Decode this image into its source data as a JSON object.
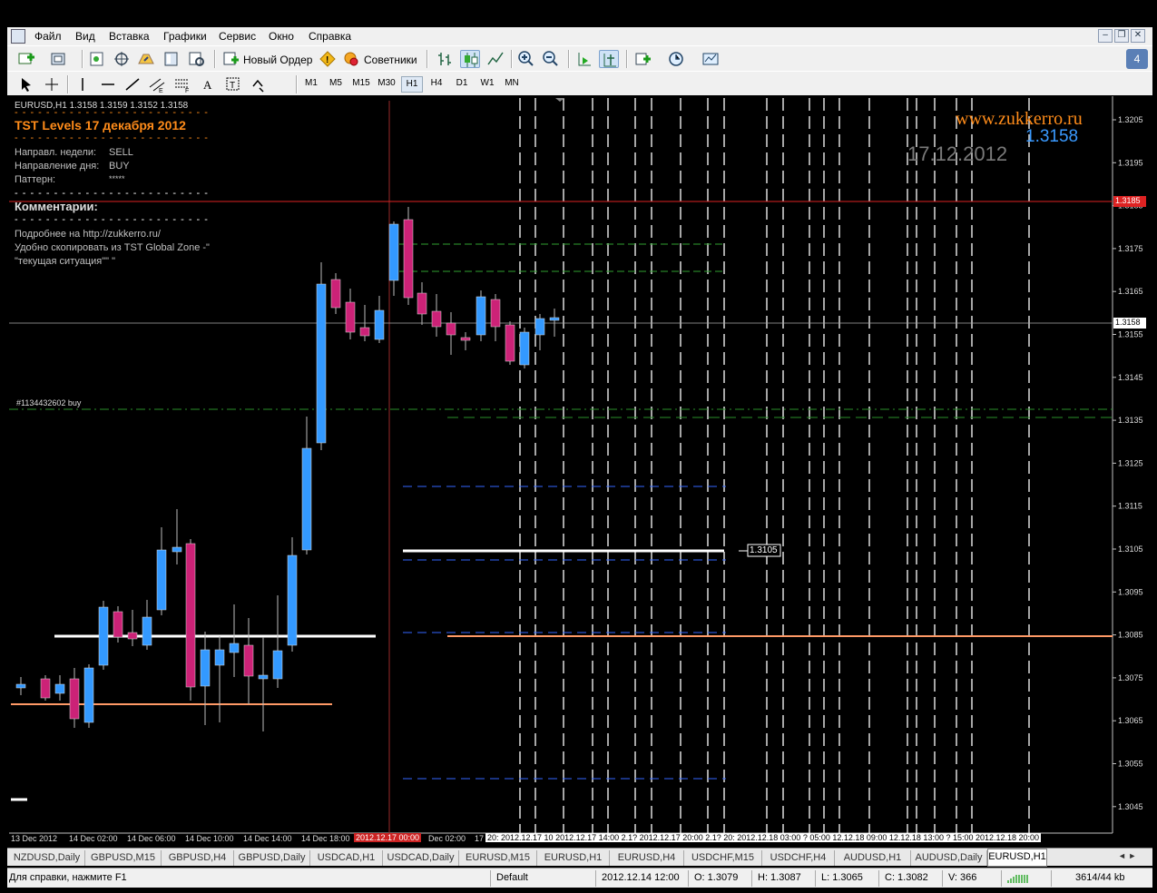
{
  "menu": [
    "Файл",
    "Вид",
    "Вставка",
    "Графики",
    "Сервис",
    "Окно",
    "Справка"
  ],
  "toolbar": {
    "new_order": "Новый Ордер",
    "advisors": "Советники",
    "timeframes": [
      "M1",
      "M5",
      "M15",
      "M30",
      "H1",
      "H4",
      "D1",
      "W1",
      "MN"
    ],
    "active_timeframe": "H1",
    "badge_count": "4"
  },
  "chart": {
    "symbol_header": "EURUSD,H1  1.3158 1.3159 1.3152 1.3158",
    "panel": {
      "title": "TST Levels   17 декабря 2012",
      "dashes": "- - - - - - - - - - - - - - - - - - - - - - - - -",
      "rows": [
        {
          "label": "Направл. недели:",
          "value": "SELL"
        },
        {
          "label": "Направление дня:",
          "value": "BUY"
        },
        {
          "label": "Паттерн:",
          "value": "*****"
        }
      ],
      "comments_title": "Комментарии:",
      "comment_line1": "Подробнее на  http://zukkerro.ru/",
      "comment_line2": "Удобно скопировать из TST Global Zone -\"",
      "comment_line3": "\"текущая ситуация\"\" \""
    },
    "watermark_url": "www.zukkerro.ru",
    "watermark_price": "1.3158",
    "watermark_date": "17.12.2012",
    "order_label": "#1134432602 buy",
    "level_label": "1.3105",
    "price_axis": [
      "1.3205",
      "1.3195",
      "1.3185",
      "1.3175",
      "1.3165",
      "1.3155",
      "1.3145",
      "1.3135",
      "1.3125",
      "1.3115",
      "1.3105",
      "1.3095",
      "1.3085",
      "1.3075",
      "1.3065",
      "1.3055",
      "1.3045"
    ],
    "price_red_marker": "1.3185",
    "price_current_marker": "1.3158",
    "time_axis": [
      "13 Dec 2012",
      "14 Dec 02:00",
      "14 Dec 06:00",
      "14 Dec 10:00",
      "14 Dec 14:00",
      "14 Dec 18:00",
      "2012.12.17 00:00",
      "Dec 02:00",
      "17"
    ],
    "time_axis_future": "20: 2012.12.17 10  2012.12.17 14:00  2.1? 2012.12.17 20:00  2.1? 20: 2012.12.18 03:00  ? 05:00 12.12.18 09:00 12.12.18 13:00 ? 15:00  2012.12.18 20:00",
    "colors": {
      "bull": "#3399ff",
      "bear": "#cc2277",
      "red_line": "#ff2222",
      "orange_line": "#ff9966",
      "green_dash": "#33cc33",
      "blue_dash": "#3366ff"
    }
  },
  "tabs": [
    "NZDUSD,Daily",
    "GBPUSD,M15",
    "GBPUSD,H4",
    "GBPUSD,Daily",
    "USDCAD,H1",
    "USDCAD,Daily",
    "EURUSD,M15",
    "EURUSD,H1",
    "EURUSD,H4",
    "USDCHF,M15",
    "USDCHF,H4",
    "AUDUSD,H1",
    "AUDUSD,Daily",
    "EURUSD,H1"
  ],
  "active_tab": 13,
  "status": {
    "help": "Для справки, нажмите F1",
    "profile": "Default",
    "datetime": "2012.12.14 12:00",
    "open": "O: 1.3079",
    "high": "H: 1.3087",
    "low": "L: 1.3065",
    "close": "C: 1.3082",
    "volume": "V: 366",
    "traffic": "3614/44 kb"
  }
}
